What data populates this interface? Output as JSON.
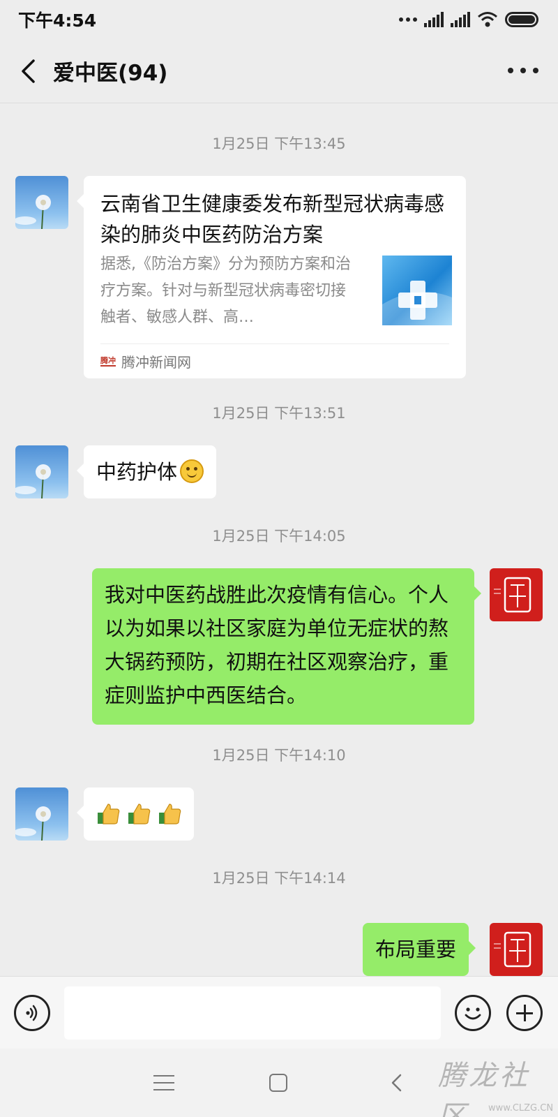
{
  "status": {
    "time": "下午4:54"
  },
  "header": {
    "title": "爱中医(94)"
  },
  "messages": [
    {
      "timestamp": "1月25日 下午13:45",
      "card": {
        "title": "云南省卫生健康委发布新型冠状病毒感染的肺炎中医药防治方案",
        "description": "据悉,《防治方案》分为预防方案和治疗方案。针对与新型冠状病毒密切接触者、敏感人群、高…",
        "source": "腾冲新闻网",
        "source_logo": "腾冲"
      }
    },
    {
      "timestamp": "1月25日 下午13:51",
      "text": "中药护体",
      "emoji": "smile-emoji"
    },
    {
      "timestamp": "1月25日 下午14:05",
      "text": "我对中医药战胜此次疫情有信心。个人以为如果以社区家庭为单位无症状的熬大锅药预防，初期在社区观察治疗，重症则监护中西医结合。"
    },
    {
      "timestamp": "1月25日 下午14:10",
      "emojis": [
        "thumbs-up-emoji",
        "thumbs-up-emoji",
        "thumbs-up-emoji"
      ]
    },
    {
      "timestamp": "1月25日 下午14:14",
      "text": "布局重要"
    }
  ],
  "input": {
    "placeholder": ""
  },
  "watermark": {
    "text": "腾龙社区",
    "url": "www.CLZG.CN"
  },
  "colors": {
    "background": "#ededed",
    "sent_bubble": "#95ec69",
    "received_bubble": "#ffffff",
    "avatar_red": "#d01f1c"
  }
}
